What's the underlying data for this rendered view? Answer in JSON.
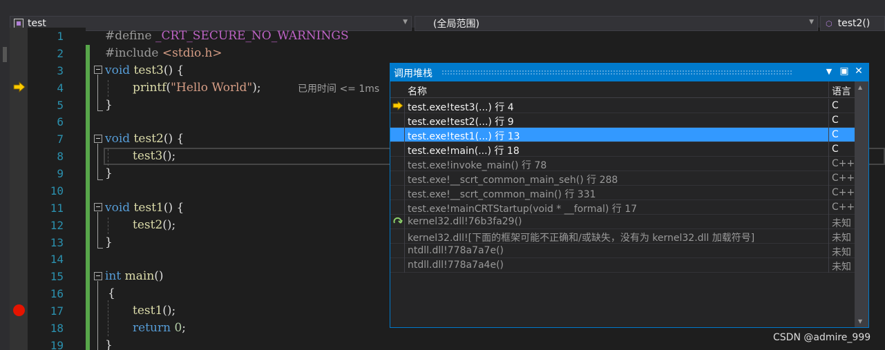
{
  "navbar": {
    "project": "test",
    "scope": "(全局范围)",
    "member": "test2()"
  },
  "editor": {
    "line_numbers": [
      "1",
      "2",
      "3",
      "4",
      "5",
      "6",
      "7",
      "8",
      "9",
      "10",
      "11",
      "12",
      "13",
      "14",
      "15",
      "16",
      "17",
      "18",
      "19"
    ],
    "lines": {
      "l1": {
        "a": "#define ",
        "b": "_CRT_SECURE_NO_WARNINGS"
      },
      "l2": {
        "a": "#include ",
        "b": "<stdio.h>"
      },
      "l3": {
        "kw": "void",
        "fn": " test3",
        "rest": "() {"
      },
      "l4": {
        "fn": "printf",
        "p1": "(",
        "str": "\"Hello World\"",
        "p2": ");"
      },
      "l5": {
        "rest": "}"
      },
      "l7": {
        "kw": "void",
        "fn": " test2",
        "rest": "() {"
      },
      "l8": {
        "fn": "test3",
        "rest": "();"
      },
      "l9": {
        "rest": "}"
      },
      "l11": {
        "kw": "void",
        "fn": " test1",
        "rest": "() {"
      },
      "l12": {
        "fn": "test2",
        "rest": "();"
      },
      "l13": {
        "rest": "}"
      },
      "l15": {
        "kw": "int",
        "fn": " main",
        "rest": "()"
      },
      "l16": {
        "rest": "{"
      },
      "l17": {
        "fn": "test1",
        "rest": "();"
      },
      "l18": {
        "kw": "return",
        "num": " 0",
        "rest": ";"
      },
      "l19": {
        "rest": "}"
      }
    },
    "perf_tip": "已用时间 <= 1ms"
  },
  "call_stack": {
    "title": "调用堆栈",
    "col_name": "名称",
    "col_lang": "语言",
    "rows": [
      {
        "name": "test.exe!test3(...) 行 4",
        "lang": "C",
        "icon": "current-frame-arrow-icon",
        "state": "normal"
      },
      {
        "name": "test.exe!test2(...) 行 9",
        "lang": "C",
        "icon": "",
        "state": "normal"
      },
      {
        "name": "test.exe!test1(...) 行 13",
        "lang": "C",
        "icon": "",
        "state": "selected"
      },
      {
        "name": "test.exe!main(...) 行 18",
        "lang": "C",
        "icon": "",
        "state": "normal"
      },
      {
        "name": "test.exe!invoke_main() 行 78",
        "lang": "C++",
        "icon": "",
        "state": "external"
      },
      {
        "name": "test.exe!__scrt_common_main_seh() 行 288",
        "lang": "C++",
        "icon": "",
        "state": "external"
      },
      {
        "name": "test.exe!__scrt_common_main() 行 331",
        "lang": "C++",
        "icon": "",
        "state": "external"
      },
      {
        "name": "test.exe!mainCRTStartup(void * __formal) 行 17",
        "lang": "C++",
        "icon": "",
        "state": "external"
      },
      {
        "name": "kernel32.dll!76b3fa29()",
        "lang": "未知",
        "icon": "thread-switch-icon",
        "state": "external"
      },
      {
        "name": "kernel32.dll![下面的框架可能不正确和/或缺失，没有为 kernel32.dll 加载符号]",
        "lang": "未知",
        "icon": "",
        "state": "external"
      },
      {
        "name": "ntdll.dll!778a7a7e()",
        "lang": "未知",
        "icon": "",
        "state": "external"
      },
      {
        "name": "ntdll.dll!778a7a4e()",
        "lang": "未知",
        "icon": "",
        "state": "external"
      }
    ]
  },
  "watermark": "CSDN @admire_999",
  "colors": {
    "accent": "#007acc",
    "selected_row": "#3399ff",
    "breakpoint": "#e51400",
    "exec_arrow": "#ffcc00"
  }
}
